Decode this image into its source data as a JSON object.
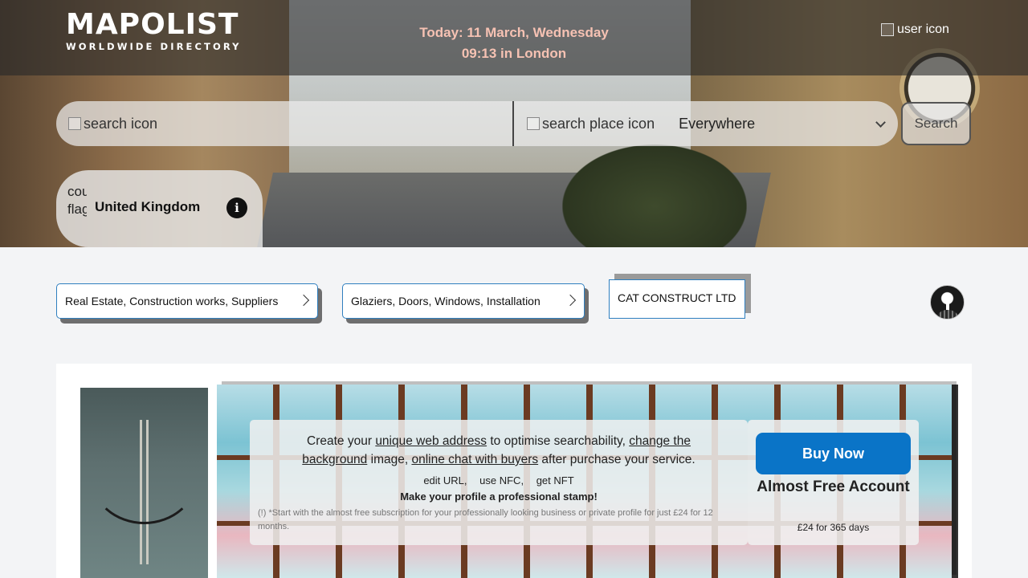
{
  "header": {
    "logo_name": "MAPOLIST",
    "logo_tagline": "WORLDWIDE DIRECTORY",
    "date_line": "Today: 11 March, Wednesday",
    "time_line": "09:13 in London",
    "user_icon_alt": "user icon"
  },
  "search": {
    "query_icon_alt": "search icon",
    "place_icon_alt": "search place icon",
    "place_value": "Everywhere",
    "button_label": "Search"
  },
  "country": {
    "flag_alt": "country flag",
    "name": "United Kingdom",
    "info_glyph": "i"
  },
  "breadcrumbs": {
    "items": [
      "Real Estate, Construction works, Suppliers",
      "Glaziers, Doors, Windows, Installation",
      "CAT CONSTRUCT LTD"
    ]
  },
  "promo": {
    "text_a": "Create your ",
    "link_1": "unique web address",
    "text_b": " to optimise searchability, ",
    "link_2": "change the background",
    "text_c": " image, ",
    "link_3": "online chat with buyers",
    "text_d": " after purchase your service.",
    "features": [
      "edit URL,",
      "use NFC,",
      "get NFT"
    ],
    "stamp": "Make your profile a professional stamp!",
    "note": "(!) *Start with the almost free subscription for your professionally looking business or private profile for just £24 for 12 months."
  },
  "buy": {
    "button_label": "Buy Now",
    "account_label": "Almost Free Account",
    "price": "£24 for 365 days"
  },
  "colors": {
    "accent": "#0a74c7",
    "date_text": "#f6c2b3",
    "crumb_border": "#2f7fbf"
  }
}
